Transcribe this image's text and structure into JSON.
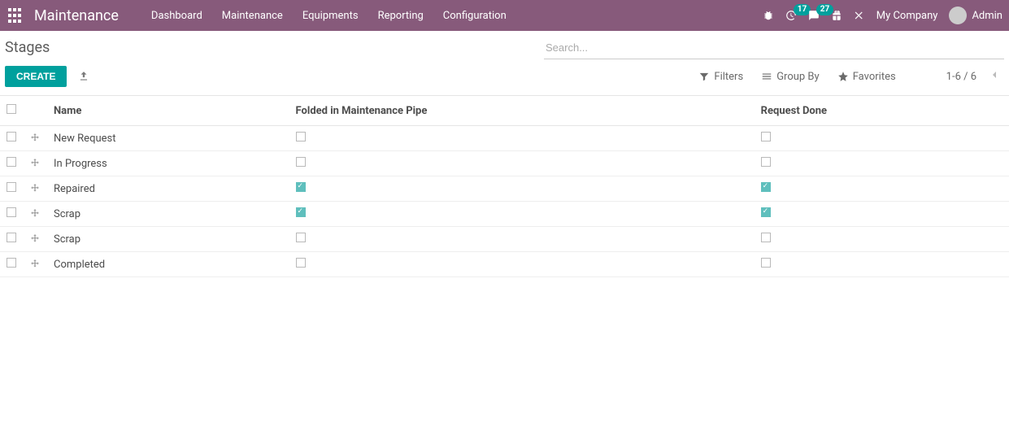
{
  "navbar": {
    "brand": "Maintenance",
    "links": [
      "Dashboard",
      "Maintenance",
      "Equipments",
      "Reporting",
      "Configuration"
    ],
    "badge1": "17",
    "badge2": "27",
    "company": "My Company",
    "user": "Admin"
  },
  "cp": {
    "title": "Stages",
    "create": "CREATE",
    "search_placeholder": "Search...",
    "filters": "Filters",
    "groupby": "Group By",
    "favorites": "Favorites",
    "pager": "1-6 / 6"
  },
  "table": {
    "headers": {
      "name": "Name",
      "folded": "Folded in Maintenance Pipe",
      "done": "Request Done"
    },
    "rows": [
      {
        "name": "New Request",
        "folded": false,
        "done": false
      },
      {
        "name": "In Progress",
        "folded": false,
        "done": false
      },
      {
        "name": "Repaired",
        "folded": true,
        "done": true
      },
      {
        "name": "Scrap",
        "folded": true,
        "done": true
      },
      {
        "name": "Scrap",
        "folded": false,
        "done": false
      },
      {
        "name": "Completed",
        "folded": false,
        "done": false
      }
    ]
  }
}
